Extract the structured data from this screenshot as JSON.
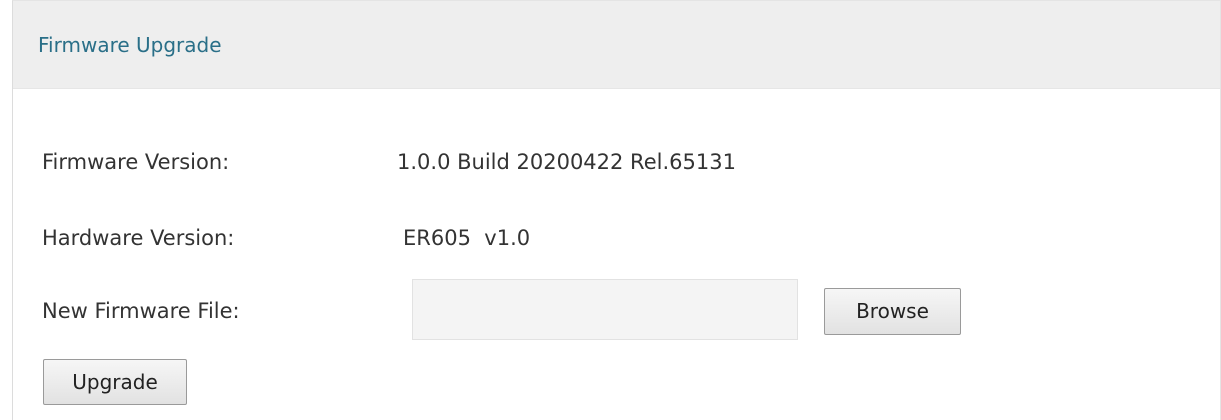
{
  "panel": {
    "title": "Firmware Upgrade"
  },
  "fields": {
    "firmware_version": {
      "label": "Firmware Version:",
      "value": "1.0.0 Build 20200422 Rel.65131"
    },
    "hardware_version": {
      "label": "Hardware Version:",
      "value": "ER605  v1.0"
    },
    "new_firmware_file": {
      "label": "New Firmware File:",
      "value": ""
    }
  },
  "buttons": {
    "browse_label": "Browse",
    "upgrade_label": "Upgrade"
  }
}
